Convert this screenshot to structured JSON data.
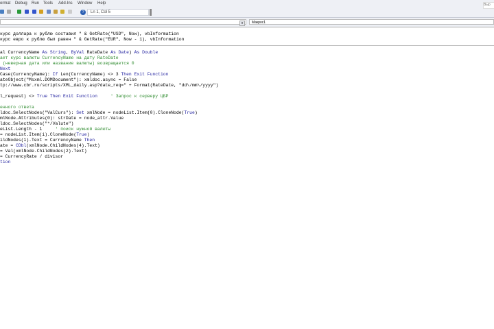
{
  "menu": [
    "ormat",
    "Debug",
    "Run",
    "Tools",
    "Add-Ins",
    "Window",
    "Help"
  ],
  "status": "Ln 1, Col 5",
  "expr_label": "Выр",
  "combo_left": "",
  "combo_right": "Макрос1",
  "code": [
    [
      {
        "t": "курс доллара к рублю составил \" & GetRate(\"USD\", Now), vbInformation",
        "c": ""
      }
    ],
    [
      {
        "t": "курс евро к рублю был равен \" & GetRate(\"EUR\", Now - 1), vbInformation",
        "c": ""
      }
    ],
    "SEP",
    [
      {
        "t": "al CurrencyName ",
        "c": ""
      },
      {
        "t": "As String",
        "c": "k"
      },
      {
        "t": ", ",
        "c": ""
      },
      {
        "t": "ByVal",
        "c": "k"
      },
      {
        "t": " RateDate ",
        "c": ""
      },
      {
        "t": "As Date",
        "c": "k"
      },
      {
        "t": ") ",
        "c": ""
      },
      {
        "t": "As Double",
        "c": "k"
      }
    ],
    [
      {
        "t": "ает курс валюты CurrencyName на дату RateDate",
        "c": "c"
      }
    ],
    [
      {
        "t": " (неверная дата или название валюты) возвращается 0",
        "c": "c"
      }
    ],
    [
      {
        "t": "Next",
        "c": "k"
      }
    ],
    [
      {
        "t": "Case(CurrencyName): ",
        "c": ""
      },
      {
        "t": "If",
        "c": "k"
      },
      {
        "t": " Len(CurrencyName) <> 3 ",
        "c": ""
      },
      {
        "t": "Then Exit Function",
        "c": "k"
      }
    ],
    [
      {
        "t": "ateObject(\"Msxml.DOMDocument\"): xmldoc.async = False",
        "c": ""
      }
    ],
    [
      {
        "t": "tp://www.cbr.ru/scripts/XML_daily.asp?date_req=\" + Format(RateDate, \"dd\\/mm\\/yyyy\")",
        "c": ""
      }
    ],
    [
      {
        "t": "",
        "c": ""
      }
    ],
    [
      {
        "t": "l_request) <> ",
        "c": ""
      },
      {
        "t": "True Then Exit Function",
        "c": "k"
      },
      {
        "t": "     ' Запрос к серверу ЦБР",
        "c": "c"
      }
    ],
    [
      {
        "t": "",
        "c": ""
      }
    ],
    [
      {
        "t": "енного ответа",
        "c": "c"
      }
    ],
    [
      {
        "t": "ldoc.SelectNodes(\"ValCurs\"): ",
        "c": ""
      },
      {
        "t": "Set",
        "c": "k"
      },
      {
        "t": " xmlNode = nodeList.Item(0).CloneNode(",
        "c": ""
      },
      {
        "t": "True",
        "c": "k"
      },
      {
        "t": ")",
        "c": ""
      }
    ],
    [
      {
        "t": "mlNode.Attributes(0): strDate = node_attr.Value",
        "c": ""
      }
    ],
    [
      {
        "t": "ldoc.SelectNodes(\"*/Valute\")",
        "c": ""
      }
    ],
    [
      {
        "t": "eList.Length - 1     ",
        "c": ""
      },
      {
        "t": "' поиск нужной валюты",
        "c": "c"
      }
    ],
    [
      {
        "t": "= nodeList.Item(i).CloneNode(",
        "c": ""
      },
      {
        "t": "True",
        "c": "k"
      },
      {
        "t": ")",
        "c": ""
      }
    ],
    [
      {
        "t": "ildNodes(1).Text = CurrencyName ",
        "c": ""
      },
      {
        "t": "Then",
        "c": "k"
      }
    ],
    [
      {
        "t": "ate = ",
        "c": ""
      },
      {
        "t": "CDbl",
        "c": "k"
      },
      {
        "t": "(xmlNode.ChildNodes(4).Text)",
        "c": ""
      }
    ],
    [
      {
        "t": "= Val(xmlNode.ChildNodes(2).Text)",
        "c": ""
      }
    ],
    [
      {
        "t": "= CurrencyRate / divisor",
        "c": ""
      }
    ],
    [
      {
        "t": "tion",
        "c": "k"
      }
    ]
  ],
  "toolbar_colors": [
    "#4a7fc1",
    "#aaa",
    "#2a9a3a",
    "#3355cc",
    "#3355cc",
    "#d4a020",
    "#6a8ac8",
    "#c8a040",
    "#d0b030",
    "#ccc"
  ]
}
